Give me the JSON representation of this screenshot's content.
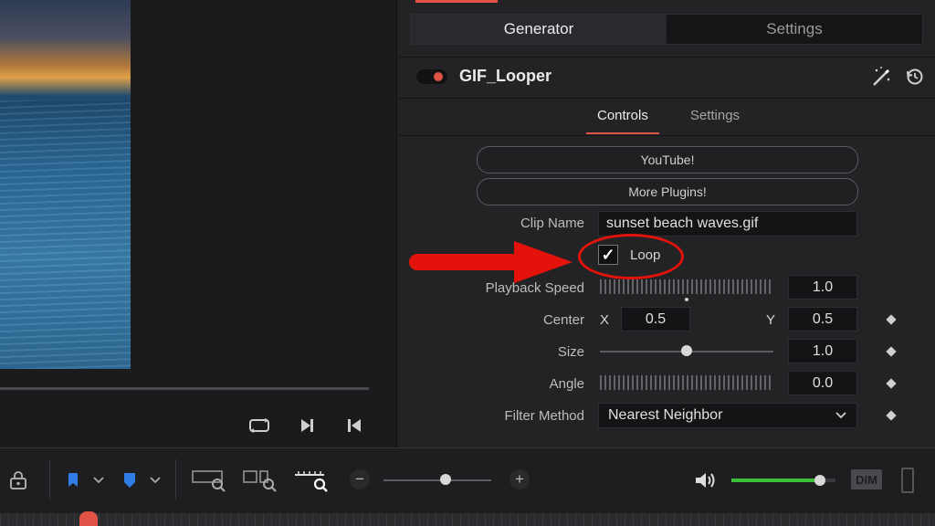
{
  "inspector": {
    "mode_tabs": [
      "Generator",
      "Settings"
    ],
    "node_title": "GIF_Looper",
    "sub_tabs": [
      "Controls",
      "Settings"
    ],
    "buttons": {
      "youtube": "YouTube!",
      "more_plugins": "More Plugins!"
    },
    "clip_name": {
      "label": "Clip Name",
      "value": "sunset beach waves.gif"
    },
    "loop": {
      "label": "Loop",
      "checked": true,
      "check_glyph": "✓"
    },
    "playback_speed": {
      "label": "Playback Speed",
      "value": "1.0"
    },
    "center": {
      "label": "Center",
      "x_label": "X",
      "x_value": "0.5",
      "y_label": "Y",
      "y_value": "0.5"
    },
    "size": {
      "label": "Size",
      "value": "1.0"
    },
    "angle": {
      "label": "Angle",
      "value": "0.0"
    },
    "filter_method": {
      "label": "Filter Method",
      "value": "Nearest Neighbor"
    }
  },
  "bottom_bar": {
    "dim_label": "DIM",
    "zoom_minus": "−",
    "zoom_plus": "+",
    "volume_level": 0.85
  },
  "colors": {
    "accent": "#e05245",
    "annotation": "#e3120b",
    "volume": "#3cc03c"
  },
  "icons": [
    "magic-wand-icon",
    "reset-icon",
    "loop-icon",
    "next-frame-icon",
    "go-to-start-icon",
    "lock-icon",
    "blue-flag-icon",
    "blue-marker-icon",
    "zoom-full-icon",
    "zoom-detail-icon",
    "zoom-custom-icon",
    "speaker-icon",
    "panel-toggle-icon",
    "diamond-keyframe-icon",
    "chevron-down-icon"
  ]
}
